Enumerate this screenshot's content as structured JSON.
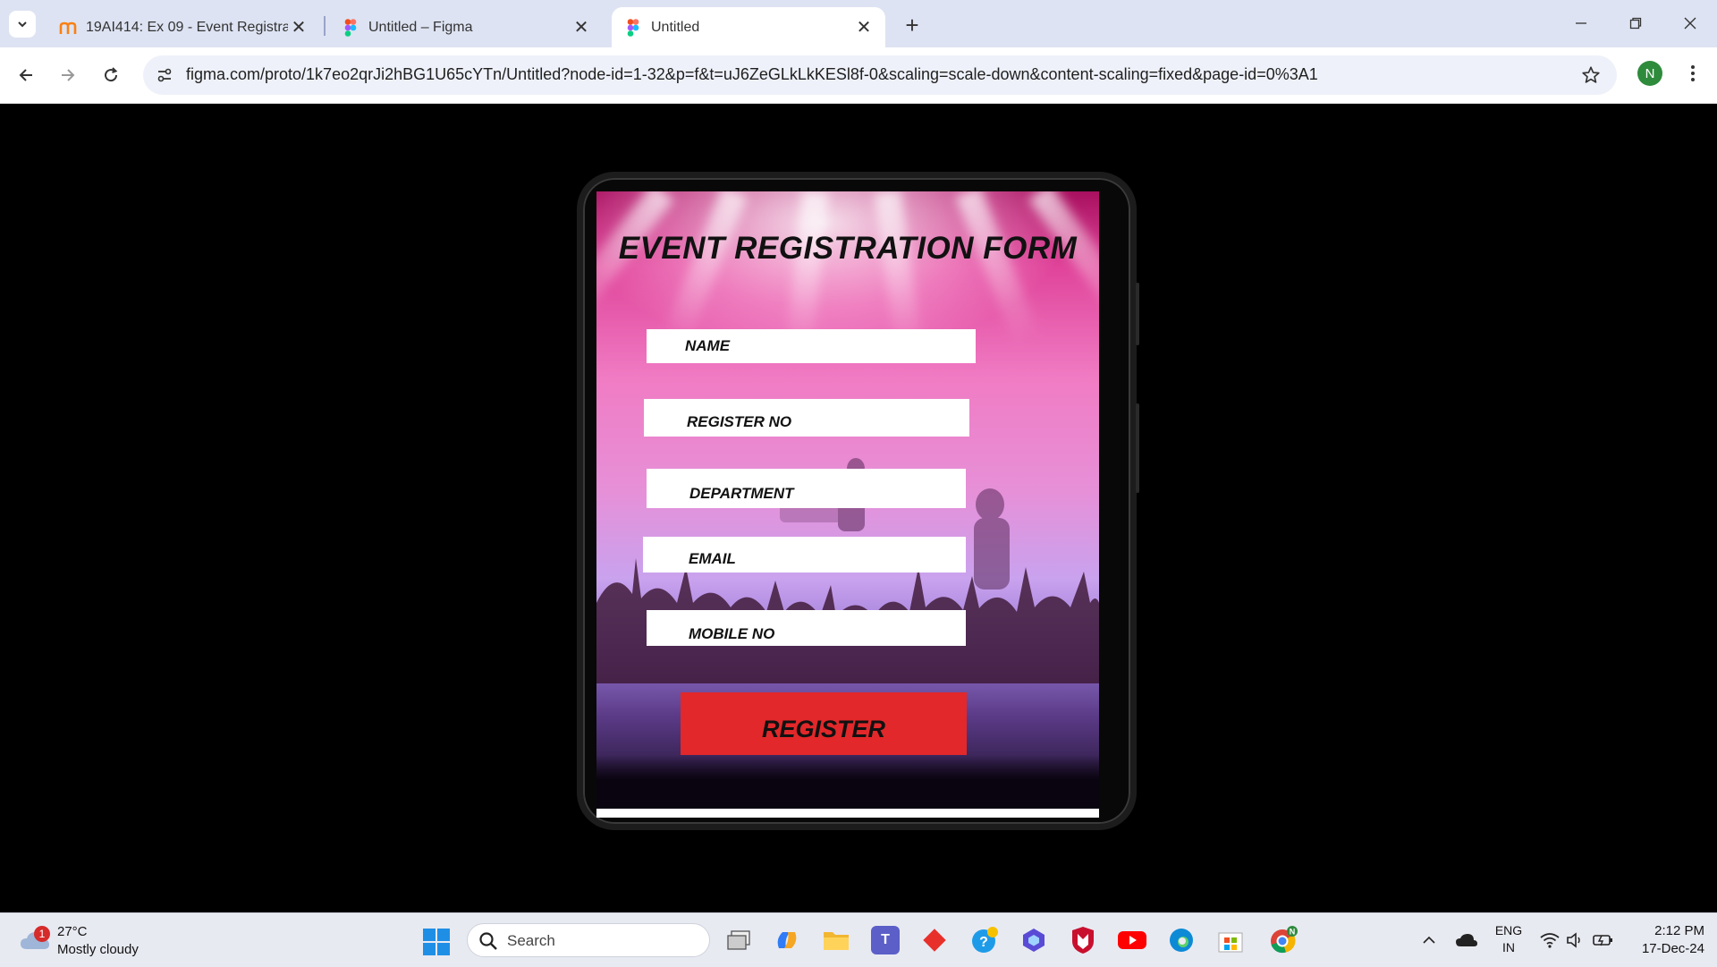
{
  "browser": {
    "tabs": [
      {
        "title": "19AI414: Ex 09 - Event Registratior",
        "favicon": "moodle-icon"
      },
      {
        "title": "Untitled – Figma",
        "favicon": "figma-icon"
      },
      {
        "title": "Untitled",
        "favicon": "figma-icon"
      }
    ],
    "active_tab_index": 2,
    "url": "figma.com/proto/1k7eo2qrJi2hBG1U65cYTn/Untitled?node-id=1-32&p=f&t=uJ6ZeGLkLkKESl8f-0&scaling=scale-down&content-scaling=fixed&page-id=0%3A1",
    "profile_initial": "N",
    "accent": "#2e8b3c"
  },
  "form": {
    "title": "EVENT REGISTRATION FORM",
    "fields": [
      {
        "label": "NAME"
      },
      {
        "label": "REGISTER NO"
      },
      {
        "label": "DEPARTMENT"
      },
      {
        "label": "EMAIL"
      },
      {
        "label": "MOBILE NO"
      }
    ],
    "submit_label": "REGISTER",
    "submit_color": "#e2282a"
  },
  "taskbar": {
    "weather": {
      "temperature": "27°C",
      "condition": "Mostly cloudy",
      "badge": "1"
    },
    "search_label": "Search",
    "language": {
      "line1": "ENG",
      "line2": "IN"
    },
    "time": "2:12 PM",
    "date": "17-Dec-24",
    "apps": [
      "task-view-icon",
      "copilot-icon",
      "file-explorer-icon",
      "teams-icon",
      "git-app-icon",
      "help-icon",
      "video-app-icon",
      "mcafee-icon",
      "youtube-icon",
      "edge-icon",
      "store-icon",
      "chrome-icon"
    ]
  }
}
